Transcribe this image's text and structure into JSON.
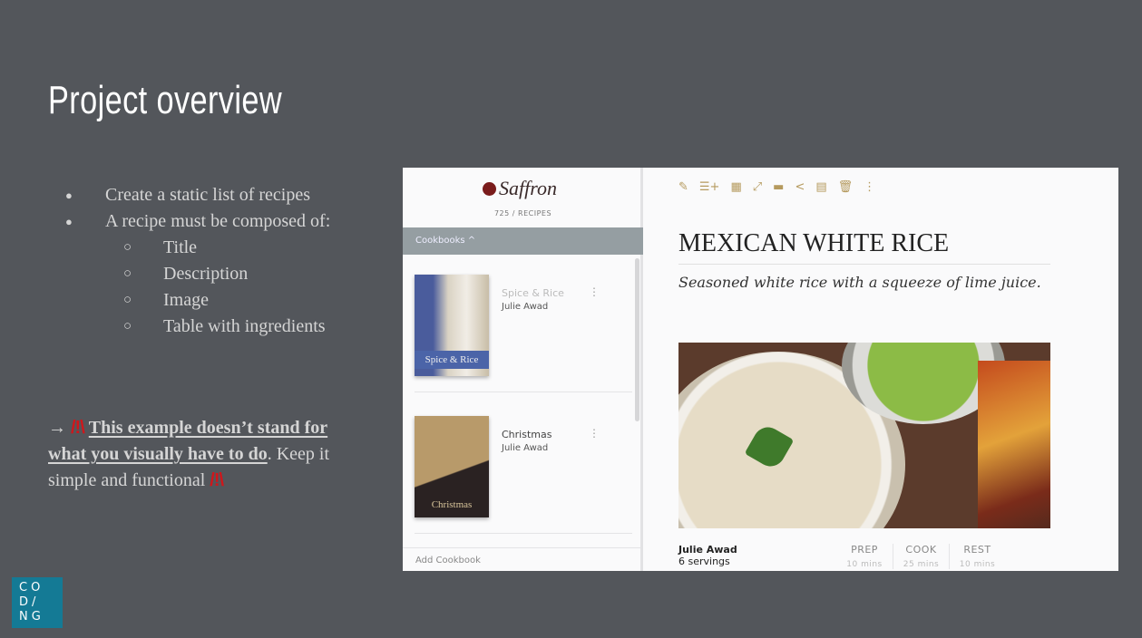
{
  "slide": {
    "title": "Project overview",
    "bullets": [
      "Create a static list of recipes",
      "A recipe must be composed of:"
    ],
    "sub_bullets": [
      "Title",
      "Description",
      "Image",
      "Table with ingredients"
    ],
    "note": {
      "arrow": "→",
      "warn": "/!\\",
      "underlined": "This example doesn’t stand for what you visually have to do",
      "rest": ". Keep it simple and functional"
    },
    "logo": "CO D/ NG"
  },
  "app": {
    "brand": "Saffron",
    "count": "725 / RECIPES",
    "cookbooks_label": "Cookbooks ^",
    "cookbooks": [
      {
        "name": "Spice & Rice",
        "author": "Julie Awad",
        "cover_text": "Spice & Rice"
      },
      {
        "name": "Christmas",
        "author": "Julie Awad",
        "cover_text": "Christmas"
      }
    ],
    "more": "⋮",
    "add_cookbook": "Add Cookbook",
    "toolbar": [
      "edit-icon",
      "add-list-icon",
      "calendar-icon",
      "expand-icon",
      "ruler-icon",
      "share-icon",
      "document-icon",
      "trash-icon",
      "more-icon"
    ],
    "toolbar_glyphs": [
      "✎",
      "☰+",
      "▦",
      "⤢",
      "▬",
      "<",
      "▤",
      "🗑",
      "⋮"
    ],
    "recipe": {
      "title": "MEXICAN WHITE RICE",
      "description": "Seasoned white rice with a squeeze of lime juice.",
      "author": "Julie Awad",
      "servings": "6 servings",
      "times": [
        {
          "label": "PREP",
          "value": "10 mins"
        },
        {
          "label": "COOK",
          "value": "25 mins"
        },
        {
          "label": "REST",
          "value": "10 mins"
        }
      ]
    },
    "accent": "#b59a5e"
  }
}
